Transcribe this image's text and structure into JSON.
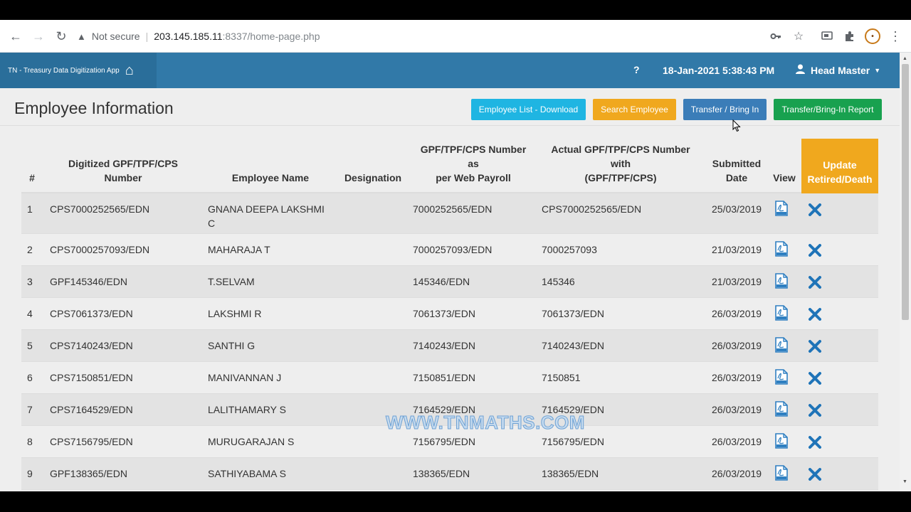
{
  "browser": {
    "security_label": "Not secure",
    "url_host": "203.145.185.11",
    "url_path": ":8337/home-page.php"
  },
  "navbar": {
    "brand": "TN - Treasury Data Digitization App",
    "help": "?",
    "datetime": "18-Jan-2021 5:38:43 PM",
    "user": "Head Master"
  },
  "page": {
    "title": "Employee Information",
    "buttons": {
      "download": "Employee List - Download",
      "search": "Search Employee",
      "transfer": "Transfer / Bring In",
      "report": "Transfer/Bring-In Report"
    }
  },
  "colors": {
    "navbar": "#3179a8",
    "btn_download": "#1fb5e2",
    "btn_search": "#f0a81e",
    "btn_transfer": "#3b7db8",
    "btn_report": "#18a14f",
    "update_header": "#f0a81e",
    "pdf_icon": "#2f7fc1",
    "delete_icon": "#1f74b8"
  },
  "table": {
    "headers": {
      "num": "#",
      "digitized_1": "Digitized GPF/TPF/CPS",
      "digitized_2": "Number",
      "name": "Employee Name",
      "designation": "Designation",
      "payroll_1": "GPF/TPF/CPS Number",
      "payroll_2": "as",
      "payroll_3": "per Web Payroll",
      "actual_1": "Actual GPF/TPF/CPS Number",
      "actual_2": "with",
      "actual_3": "(GPF/TPF/CPS)",
      "submitted_1": "Submitted",
      "submitted_2": "Date",
      "view": "View",
      "update_1": "Update",
      "update_2": "Retired/Death"
    },
    "rows": [
      {
        "num": "1",
        "digitized": "CPS7000252565/EDN",
        "name_1": "GNANA DEEPA LAKSHMI",
        "name_2": "C",
        "designation": "",
        "payroll": "7000252565/EDN",
        "actual": "CPS7000252565/EDN",
        "date": "25/03/2019"
      },
      {
        "num": "2",
        "digitized": "CPS7000257093/EDN",
        "name_1": "MAHARAJA T",
        "name_2": "",
        "designation": "",
        "payroll": "7000257093/EDN",
        "actual": "7000257093",
        "date": "21/03/2019"
      },
      {
        "num": "3",
        "digitized": "GPF145346/EDN",
        "name_1": "T.SELVAM",
        "name_2": "",
        "designation": "",
        "payroll": "145346/EDN",
        "actual": "145346",
        "date": "21/03/2019"
      },
      {
        "num": "4",
        "digitized": "CPS7061373/EDN",
        "name_1": "LAKSHMI R",
        "name_2": "",
        "designation": "",
        "payroll": "7061373/EDN",
        "actual": "7061373/EDN",
        "date": "26/03/2019"
      },
      {
        "num": "5",
        "digitized": "CPS7140243/EDN",
        "name_1": "SANTHI G",
        "name_2": "",
        "designation": "",
        "payroll": "7140243/EDN",
        "actual": "7140243/EDN",
        "date": "26/03/2019"
      },
      {
        "num": "6",
        "digitized": "CPS7150851/EDN",
        "name_1": "MANIVANNAN J",
        "name_2": "",
        "designation": "",
        "payroll": "7150851/EDN",
        "actual": "7150851",
        "date": "26/03/2019"
      },
      {
        "num": "7",
        "digitized": "CPS7164529/EDN",
        "name_1": "LALITHAMARY S",
        "name_2": "",
        "designation": "",
        "payroll": "7164529/EDN",
        "actual": "7164529/EDN",
        "date": "26/03/2019"
      },
      {
        "num": "8",
        "digitized": "CPS7156795/EDN",
        "name_1": "MURUGARAJAN S",
        "name_2": "",
        "designation": "",
        "payroll": "7156795/EDN",
        "actual": "7156795/EDN",
        "date": "26/03/2019"
      },
      {
        "num": "9",
        "digitized": "GPF138365/EDN",
        "name_1": "SATHIYABAMA S",
        "name_2": "",
        "designation": "",
        "payroll": "138365/EDN",
        "actual": "138365/EDN",
        "date": "26/03/2019"
      }
    ]
  },
  "watermark": "WWW.TNMATHS.COM"
}
